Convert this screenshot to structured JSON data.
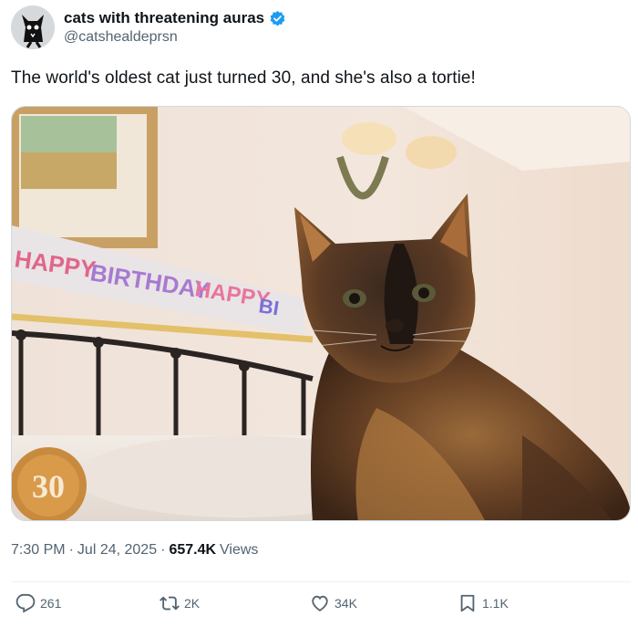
{
  "author": {
    "display_name": "cats with threatening auras",
    "handle": "@catshealdeprsn",
    "verified": true,
    "avatar_icon": "black-cat-avatar"
  },
  "tweet": {
    "text": "The world's oldest cat just turned 30, and she's also a tortie!"
  },
  "photo": {
    "description_icon": "tortoiseshell-cat-photo",
    "banner_words": [
      "HAPPY",
      "BIRTHDAY",
      "HAPPY",
      "BI"
    ],
    "balloon_number": "30"
  },
  "meta": {
    "time": "7:30 PM",
    "date": "Jul 24, 2025",
    "views_count": "657.4K",
    "views_label": "Views",
    "separator": "·"
  },
  "actions": {
    "reply_count": "261",
    "retweet_count": "2K",
    "like_count": "34K",
    "bookmark_count": "1.1K"
  },
  "colors": {
    "text_primary": "#0f1419",
    "text_secondary": "#536471",
    "verified_blue": "#1d9bf0",
    "divider": "#eff3f4"
  }
}
